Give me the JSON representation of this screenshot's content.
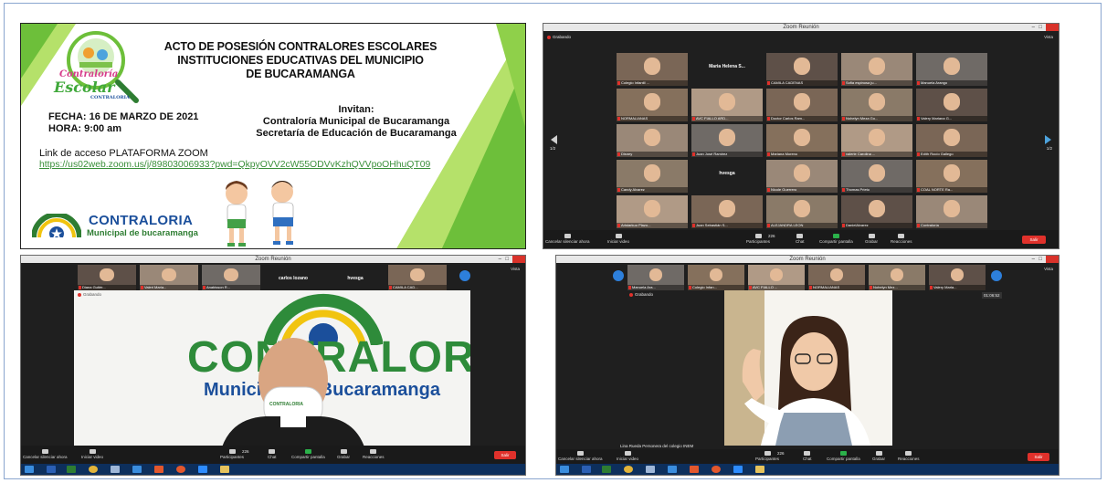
{
  "invitation": {
    "title_lines": [
      "ACTO DE POSESIÓN CONTRALORES ESCOLARES",
      "INSTITUCIONES EDUCATIVAS DEL MUNICIPIO",
      "DE BUCARAMANGA"
    ],
    "date": "FECHA: 16 DE MARZO DE 2021",
    "time": "HORA: 9:00 am",
    "invitan_label": "Invitan:",
    "host1": "Contraloría Municipal de Bucaramanga",
    "host2": "Secretaría de Educación de Bucaramanga",
    "link_label": "Link de acceso PLATAFORMA ZOOM",
    "link_url": "https://us02web.zoom.us/j/89803006933?pwd=QkpyOVV2cW55ODVvKzhQVVpoOHhuQT09",
    "badge_top": "Contraloría",
    "badge_main": "Escolar",
    "badge_small": "CONTRALORIA",
    "footer_name": "CONTRALORIA",
    "footer_sub": "Municipal de bucaramanga",
    "colors": {
      "green": "#6dbf3a",
      "light_green": "#b5e16a",
      "blue": "#1b4f9b",
      "link": "#3a8f3a"
    }
  },
  "gallery_window": {
    "title": "Zoom Reunión",
    "recording": "Grabando",
    "view": "Vista",
    "page_left": "1/2",
    "page_right": "1/2",
    "tiles": [
      {
        "name": "Colegio Infantil ..."
      },
      {
        "name": "",
        "text": "Maria Helena S..."
      },
      {
        "name": "CAMILA CADENAS"
      },
      {
        "name": "Sofia espinosa ju..."
      },
      {
        "name": "Manuela Arango"
      },
      {
        "name": "NORMALIANAS"
      },
      {
        "name": "AVC FIALLO ARD..."
      },
      {
        "name": "Doctor Carlos Ram..."
      },
      {
        "name": "Nohelyn Meza Go..."
      },
      {
        "name": "Valery Mariana G..."
      },
      {
        "name": "Disney"
      },
      {
        "name": "Juan José Ramirez"
      },
      {
        "name": "Mariana Moreno"
      },
      {
        "name": "valerie Carolina ..."
      },
      {
        "name": "Edith Rocío Gallego"
      },
      {
        "name": "Candy Alvarez"
      },
      {
        "name": "",
        "text": "hvesga"
      },
      {
        "name": "Nicole Guerrero"
      },
      {
        "name": "Thomas Prieto"
      },
      {
        "name": "COAL NORTE Ra..."
      },
      {
        "name": "Aristarkuo Plazo..."
      },
      {
        "name": "Juan Sebastián S..."
      },
      {
        "name": "ALEJANDRA LEON"
      },
      {
        "name": "DanielAlvarez"
      },
      {
        "name": "Contraloría"
      }
    ],
    "toolbar": {
      "mute": "Cancelar silenciar ahora",
      "video": "Iniciar video",
      "participants": "Participantes",
      "participants_count": "226",
      "chat": "Chat",
      "share": "Compartir pantalla",
      "record": "Grabar",
      "reactions": "Reacciones",
      "leave": "Salir"
    }
  },
  "speaker_window": {
    "title": "Zoom Reunión",
    "view": "Vista",
    "recording": "Grabando",
    "strip": [
      {
        "name": "Diana Gutiér..."
      },
      {
        "name": "Valeri Maria..."
      },
      {
        "name": "Anabisson R..."
      },
      {
        "name": "",
        "text": "carlos lozano"
      },
      {
        "name": "",
        "text": "hvesga"
      },
      {
        "name": "CAMILA CAD..."
      }
    ],
    "wall_text": "CONTRALORIA",
    "wall_sub": "Municipal de Bucaramanga",
    "mask_logo": "CONTRALORIA",
    "toolbar": {
      "mute": "Cancelar silenciar ahora",
      "video": "Iniciar video",
      "participants": "Participantes",
      "participants_count": "226",
      "chat": "Chat",
      "share": "Compartir pantalla",
      "record": "Grabar",
      "reactions": "Reacciones",
      "leave": "Salir"
    }
  },
  "student_window": {
    "title": "Zoom Reunión",
    "view": "Vista",
    "recording": "Grabando",
    "timer": "01:06:52",
    "strip": [
      {
        "name": "Manuela Ara..."
      },
      {
        "name": "Colegio Infan..."
      },
      {
        "name": "AVC FIALLO ..."
      },
      {
        "name": "NORMALIANAS"
      },
      {
        "name": "Nohelyn Mez..."
      },
      {
        "name": "Valery Maria..."
      }
    ],
    "caption": "Lina Rueda Personera del colegio INEM",
    "toolbar": {
      "mute": "Cancelar silenciar ahora",
      "video": "Iniciar video",
      "participants": "Participantes",
      "participants_count": "226",
      "chat": "Chat",
      "share": "Compartir pantalla",
      "record": "Grabar",
      "reactions": "Reacciones",
      "leave": "Salir"
    }
  }
}
